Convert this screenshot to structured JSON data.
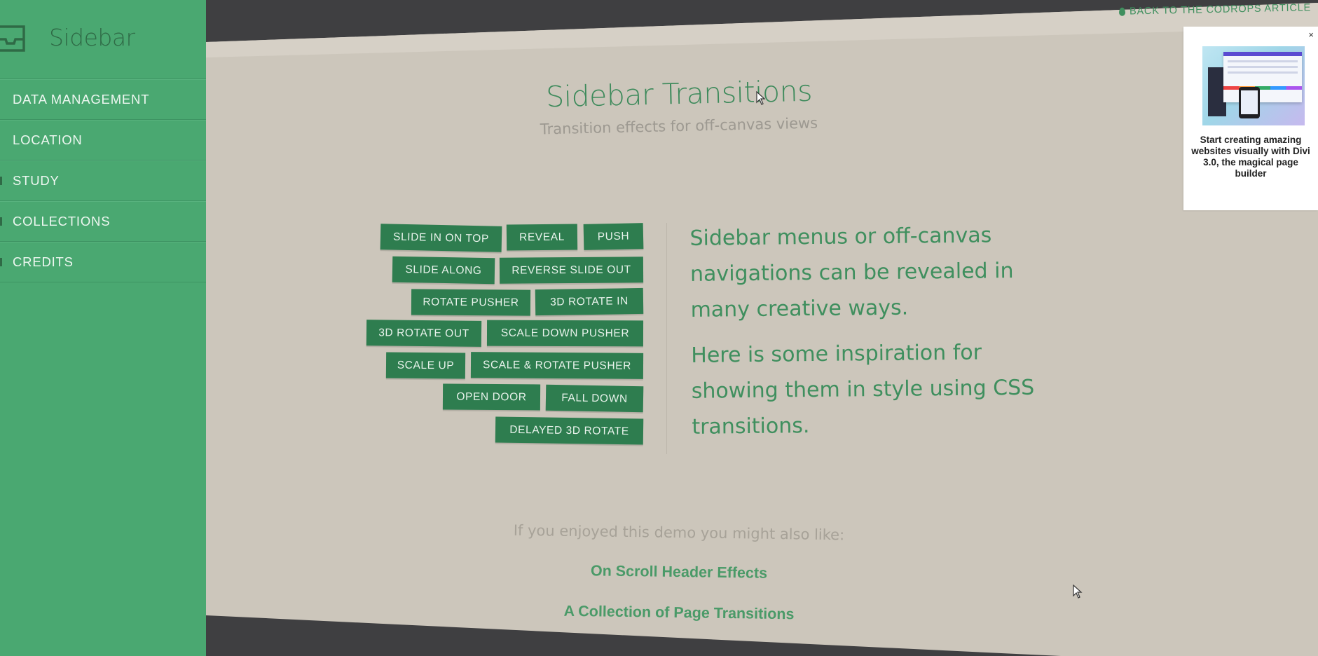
{
  "sidebar": {
    "title": "Sidebar",
    "items": [
      {
        "label": "DATA MANAGEMENT"
      },
      {
        "label": "LOCATION"
      },
      {
        "label": "STUDY"
      },
      {
        "label": "COLLECTIONS"
      },
      {
        "label": "CREDITS"
      }
    ]
  },
  "header": {
    "back_link": "BACK TO THE CODROPS ARTICLE",
    "title": "Sidebar Transitions",
    "subtitle": "Transition effects for off-canvas views"
  },
  "effects": {
    "buttons": [
      "SLIDE IN ON TOP",
      "REVEAL",
      "PUSH",
      "SLIDE ALONG",
      "REVERSE SLIDE OUT",
      "ROTATE PUSHER",
      "3D ROTATE IN",
      "3D ROTATE OUT",
      "SCALE DOWN PUSHER",
      "SCALE UP",
      "SCALE & ROTATE PUSHER",
      "OPEN DOOR",
      "FALL DOWN",
      "DELAYED 3D ROTATE"
    ]
  },
  "intro": {
    "paragraph1": "Sidebar menus or off-canvas navigations can be revealed in many creative ways.",
    "paragraph2": "Here is some inspiration for showing them in style using CSS transitions."
  },
  "related": {
    "lead": "If you enjoyed this demo you might also like:",
    "links": [
      "On Scroll Header Effects",
      "A Collection of Page Transitions"
    ]
  },
  "ad": {
    "close": "×",
    "text": "Start creating amazing websites visually with Divi 3.0, the magical page builder"
  },
  "colors": {
    "sidebar": "#4aa871",
    "button": "#2e7d4f",
    "page": "#ccc6bb",
    "accent": "#3f8f5e"
  }
}
